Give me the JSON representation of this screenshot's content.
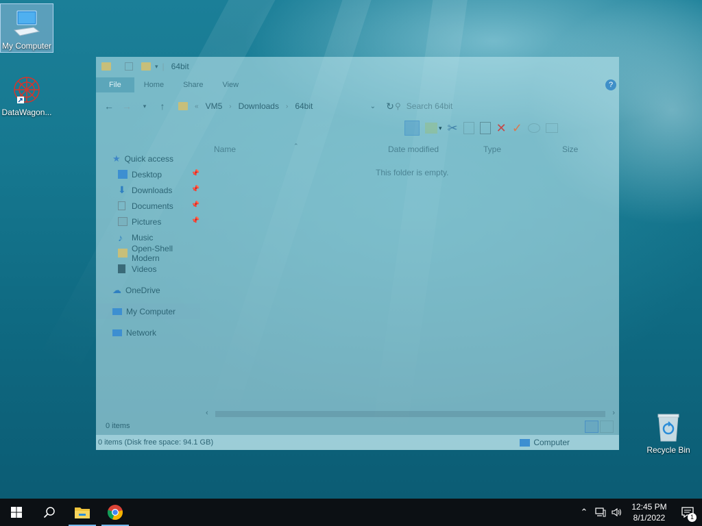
{
  "desktop": {
    "icons": [
      {
        "label": "My Computer",
        "icon": "computer-icon"
      },
      {
        "label": "DataWagon...",
        "icon": "datawagon-shortcut-icon"
      }
    ],
    "recycle_bin": {
      "label": "Recycle Bin",
      "icon": "recycle-bin-icon"
    }
  },
  "explorer": {
    "title": "64bit",
    "ribbon_tabs": [
      "File",
      "Home",
      "Share",
      "View"
    ],
    "breadcrumb": [
      "VM5",
      "Downloads",
      "64bit"
    ],
    "search_placeholder": "Search 64bit",
    "columns": [
      "Name",
      "Date modified",
      "Type",
      "Size"
    ],
    "empty_message": "This folder is empty.",
    "nav": {
      "quick_access": "Quick access",
      "quick_items": [
        "Desktop",
        "Downloads",
        "Documents",
        "Pictures",
        "Music",
        "Open-Shell Modern",
        "Videos"
      ],
      "onedrive": "OneDrive",
      "my_computer": "My Computer",
      "network": "Network"
    },
    "status_items": "0 items",
    "details_text": "0 items (Disk free space: 94.1 GB)",
    "details_location": "Computer"
  },
  "taskbar": {
    "time": "12:45 PM",
    "date": "8/1/2022",
    "notification_count": "1",
    "pinned": [
      "start-button",
      "search-button",
      "file-explorer",
      "chrome"
    ]
  }
}
